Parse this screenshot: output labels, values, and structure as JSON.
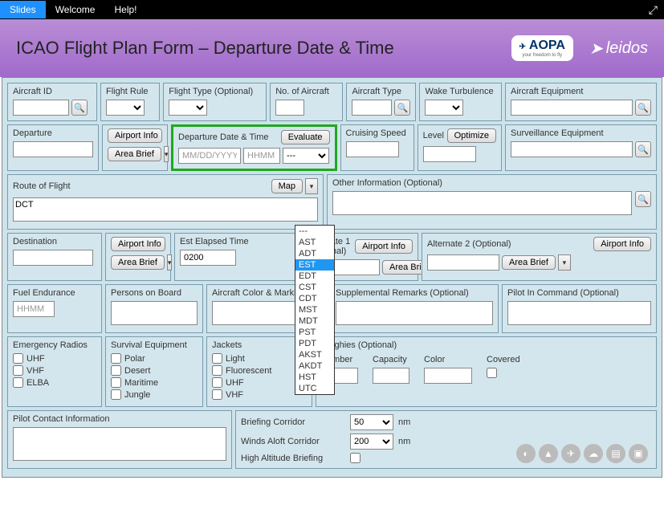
{
  "topbar": {
    "slides": "Slides",
    "welcome": "Welcome",
    "help": "Help!"
  },
  "header": {
    "title": "ICAO Flight Plan Form – Departure Date & Time",
    "aopa": "AOPA",
    "aopa_sub": "your freedom to fly",
    "leidos": "leidos"
  },
  "labels": {
    "aircraft_id": "Aircraft ID",
    "flight_rule": "Flight Rule",
    "flight_type": "Flight Type (Optional)",
    "no_aircraft": "No. of Aircraft",
    "aircraft_type": "Aircraft Type",
    "wake": "Wake Turbulence",
    "equipment": "Aircraft Equipment",
    "departure": "Departure",
    "airport_info": "Airport Info",
    "area_brief": "Area Brief",
    "depart_dt": "Departure Date & Time",
    "evaluate": "Evaluate",
    "cruising": "Cruising Speed",
    "level": "Level",
    "optimize": "Optimize",
    "surveillance": "Surveillance Equipment",
    "route": "Route of Flight",
    "map": "Map",
    "other_info": "Other Information (Optional)",
    "destination": "Destination",
    "elapsed": "Est Elapsed Time",
    "alt1": "Alternate 1 (Optional)",
    "alt2": "Alternate 2 (Optional)",
    "fuel": "Fuel Endurance",
    "persons": "Persons on Board",
    "color": "Aircraft Color & Markings (Optional)",
    "remarks": "Supplemental Remarks (Optional)",
    "pilot_cmd": "Pilot In Command (Optional)",
    "emerg_radios": "Emergency Radios",
    "survival": "Survival Equipment",
    "jackets": "Jackets",
    "dinghies": "Dinghies (Optional)",
    "number": "Number",
    "capacity": "Capacity",
    "color2": "Color",
    "covered": "Covered",
    "pilot_contact": "Pilot Contact Information",
    "brief_corridor": "Briefing Corridor",
    "winds": "Winds Aloft Corridor",
    "high_alt": "High Altitude Briefing",
    "nm": "nm"
  },
  "placeholders": {
    "date": "MM/DD/YYYY",
    "time": "HHMM",
    "hhmm": "HHMM"
  },
  "values": {
    "route": "DCT",
    "elapsed": "0200",
    "brief_corridor": "50",
    "winds": "200"
  },
  "checks": {
    "uhf": "UHF",
    "vhf": "VHF",
    "elba": "ELBA",
    "polar": "Polar",
    "desert": "Desert",
    "maritime": "Maritime",
    "jungle": "Jungle",
    "light": "Light",
    "fluor": "Fluorescent",
    "j_uhf": "UHF",
    "j_vhf": "VHF"
  },
  "tz": [
    "---",
    "AST",
    "ADT",
    "EST",
    "EDT",
    "CST",
    "CDT",
    "MST",
    "MDT",
    "PST",
    "PDT",
    "AKST",
    "AKDT",
    "HST",
    "UTC"
  ],
  "tz_selected": "EST"
}
